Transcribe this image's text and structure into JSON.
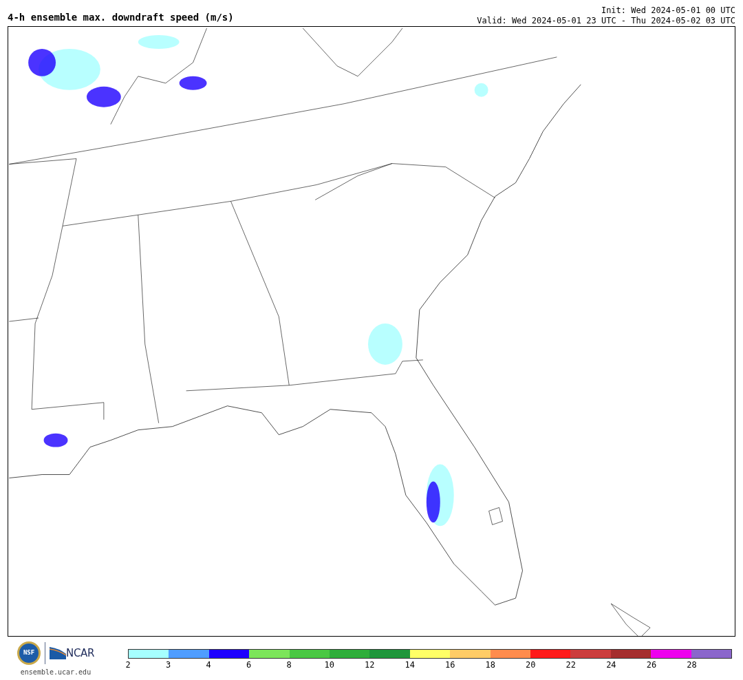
{
  "title": "4-h ensemble max. downdraft speed (m/s)",
  "init": "Init: Wed 2024-05-01 00 UTC",
  "valid": "Valid: Wed 2024-05-01 23 UTC - Thu 2024-05-02 03 UTC",
  "logos": {
    "nsf": "NSF",
    "ncar": "NCAR",
    "url": "ensemble.ucar.edu"
  },
  "colorbar": {
    "segments": [
      {
        "color": "#a6ffff"
      },
      {
        "color": "#4f9dff"
      },
      {
        "color": "#1e00ff"
      },
      {
        "color": "#7ce55a"
      },
      {
        "color": "#4ac843"
      },
      {
        "color": "#2fae3a"
      },
      {
        "color": "#1f963b"
      },
      {
        "color": "#ffff66"
      },
      {
        "color": "#ffcc66"
      },
      {
        "color": "#ff8c4d"
      },
      {
        "color": "#ff1a1a"
      },
      {
        "color": "#cc3d3d"
      },
      {
        "color": "#a52e2e"
      },
      {
        "color": "#ee00ee"
      },
      {
        "color": "#8b66cc"
      }
    ],
    "ticks": [
      "2",
      "3",
      "4",
      "6",
      "8",
      "10",
      "12",
      "14",
      "16",
      "18",
      "20",
      "22",
      "24",
      "26",
      "28"
    ]
  }
}
